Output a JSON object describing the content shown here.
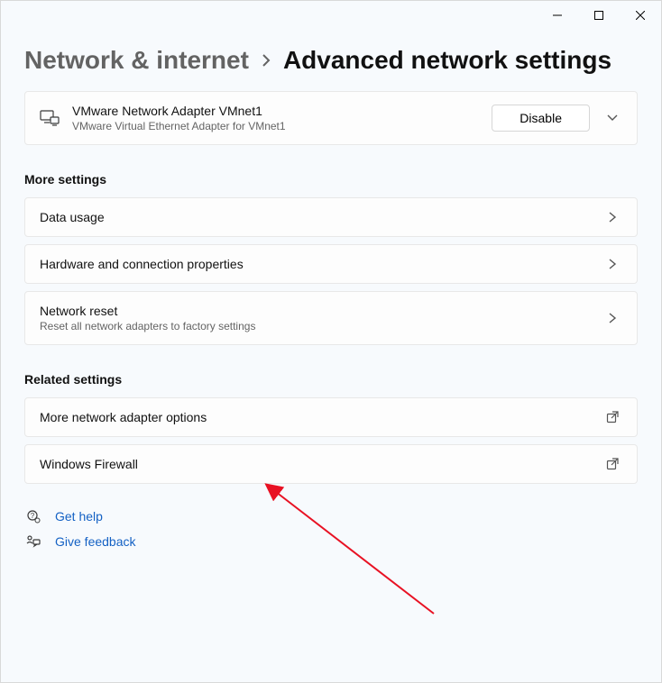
{
  "breadcrumb": {
    "parent": "Network & internet",
    "current": "Advanced network settings"
  },
  "adapter": {
    "title": "VMware Network Adapter VMnet1",
    "subtitle": "VMware Virtual Ethernet Adapter for VMnet1",
    "disable_label": "Disable"
  },
  "sections": {
    "more_settings": "More settings",
    "related_settings": "Related settings"
  },
  "more_settings_items": {
    "data_usage": {
      "title": "Data usage"
    },
    "hw_conn": {
      "title": "Hardware and connection properties"
    },
    "net_reset": {
      "title": "Network reset",
      "subtitle": "Reset all network adapters to factory settings"
    }
  },
  "related_settings_items": {
    "more_adapter": {
      "title": "More network adapter options"
    },
    "firewall": {
      "title": "Windows Firewall"
    }
  },
  "footer": {
    "get_help": "Get help",
    "give_feedback": "Give feedback"
  }
}
